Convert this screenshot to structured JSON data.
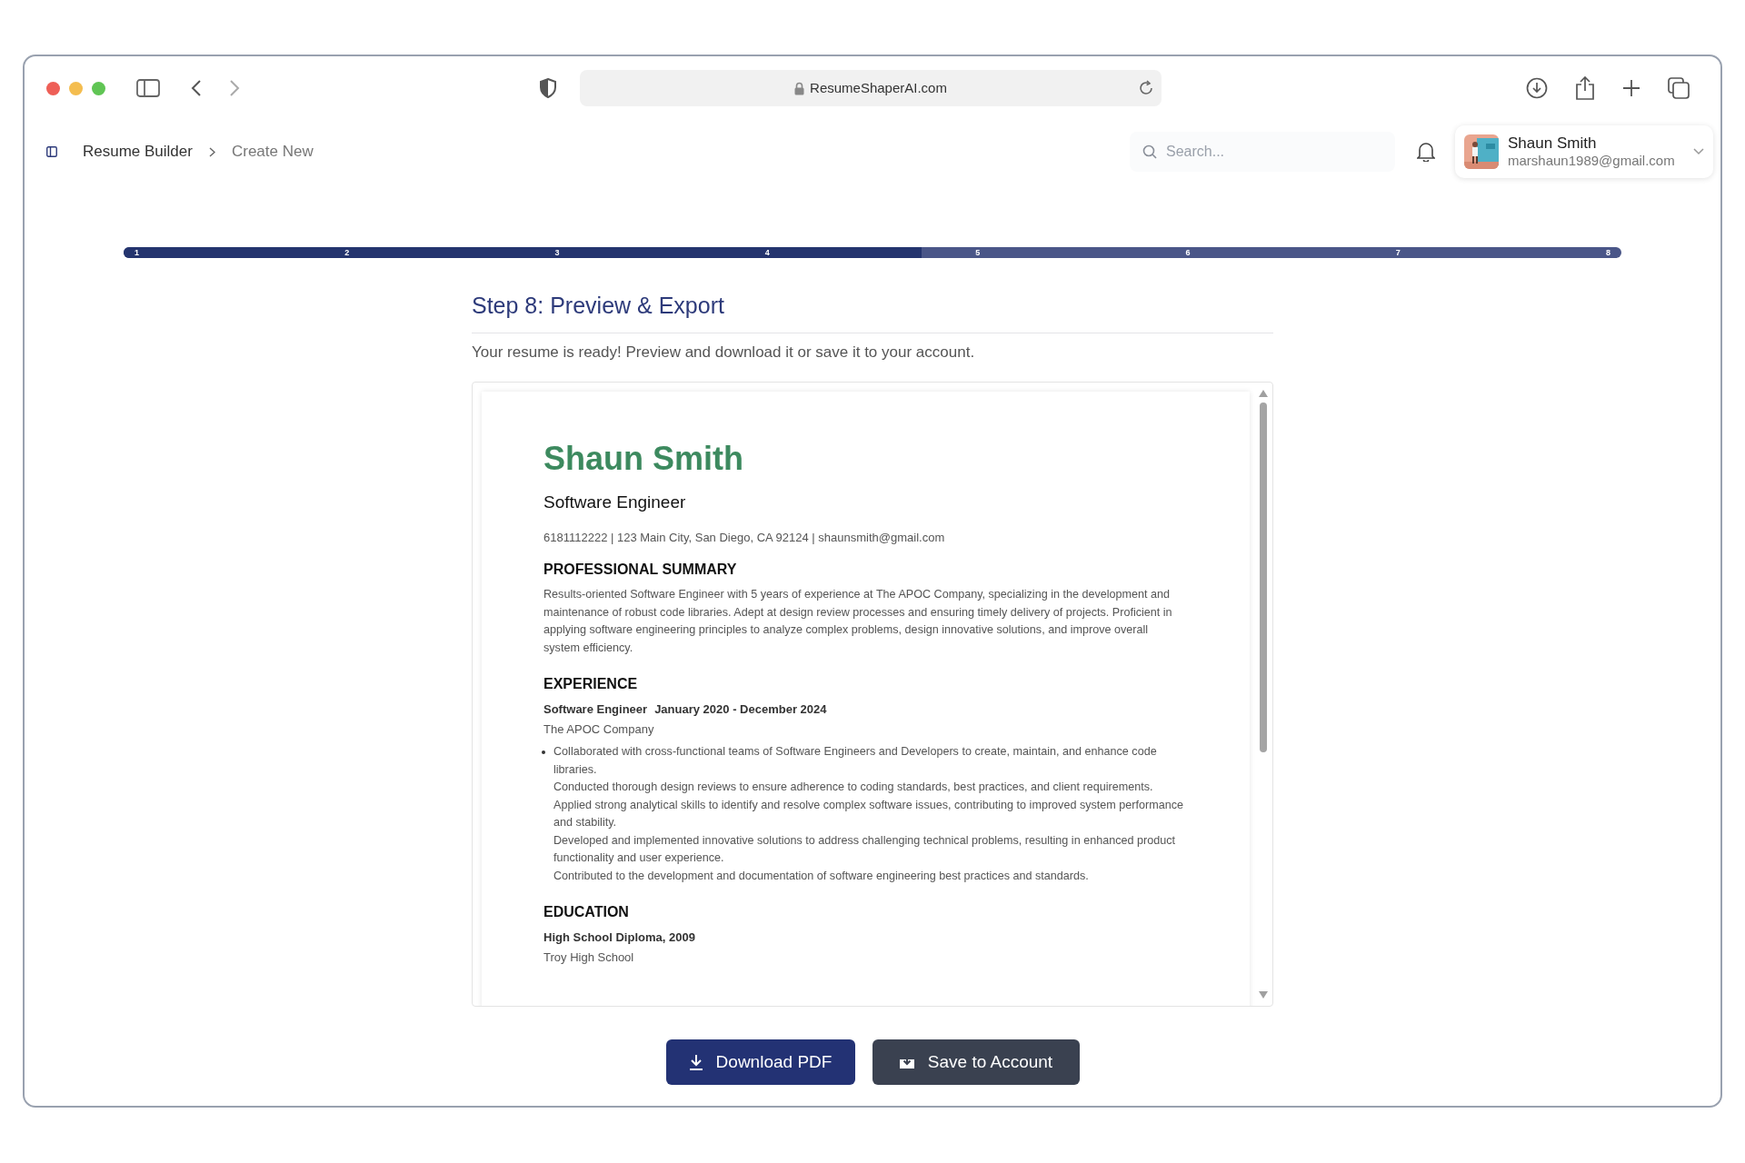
{
  "browser": {
    "address": "ResumeShaperAI.com"
  },
  "breadcrumb": [
    "Resume Builder",
    "Create New"
  ],
  "search": {
    "placeholder": "Search..."
  },
  "user": {
    "name": "Shaun Smith",
    "email": "marshaun1989@gmail.com"
  },
  "progress": {
    "level": 0.533,
    "steps": [
      "1",
      "2",
      "3",
      "4",
      "5",
      "6",
      "7",
      "8"
    ]
  },
  "step": {
    "title": "Step 8: Preview & Export",
    "description": "Your resume is ready! Preview and download it or save it to your account."
  },
  "resume": {
    "name": "Shaun Smith",
    "headline": "Software Engineer",
    "contact": "6181112222 | 123 Main City, San Diego, CA 92124 | shaunsmith@gmail.com",
    "sections": [
      {
        "kind": "summary",
        "heading": "PROFESSIONAL SUMMARY",
        "text": "Results-oriented Software Engineer with 5 years of experience at The APOC Company, specializing in the development and maintenance of robust code libraries. Adept at design review processes and ensuring timely delivery of projects. Proficient in applying software engineering principles to analyze complex problems, design innovative solutions, and improve overall system efficiency."
      },
      {
        "kind": "experience",
        "heading": "EXPERIENCE",
        "role": "Software Engineer",
        "dates": "January 2020 - December 2024",
        "org": "The APOC Company",
        "lines": [
          "Collaborated with cross-functional teams of Software Engineers and Developers to create, maintain, and enhance code libraries.",
          "Conducted thorough design reviews to ensure adherence to coding standards, best practices, and client requirements.",
          "Applied strong analytical skills to identify and resolve complex software issues, contributing to improved system performance and stability.",
          "Developed and implemented innovative solutions to address challenging technical problems, resulting in enhanced product functionality and user experience.",
          "Contributed to the development and documentation of software engineering best practices and standards."
        ]
      },
      {
        "kind": "education",
        "heading": "EDUCATION",
        "degree": "High School Diploma, 2009",
        "org": "Troy High School"
      }
    ]
  },
  "buttons": [
    {
      "kind": "download",
      "label": "Download PDF"
    },
    {
      "kind": "save",
      "label": "Save to Account"
    }
  ]
}
